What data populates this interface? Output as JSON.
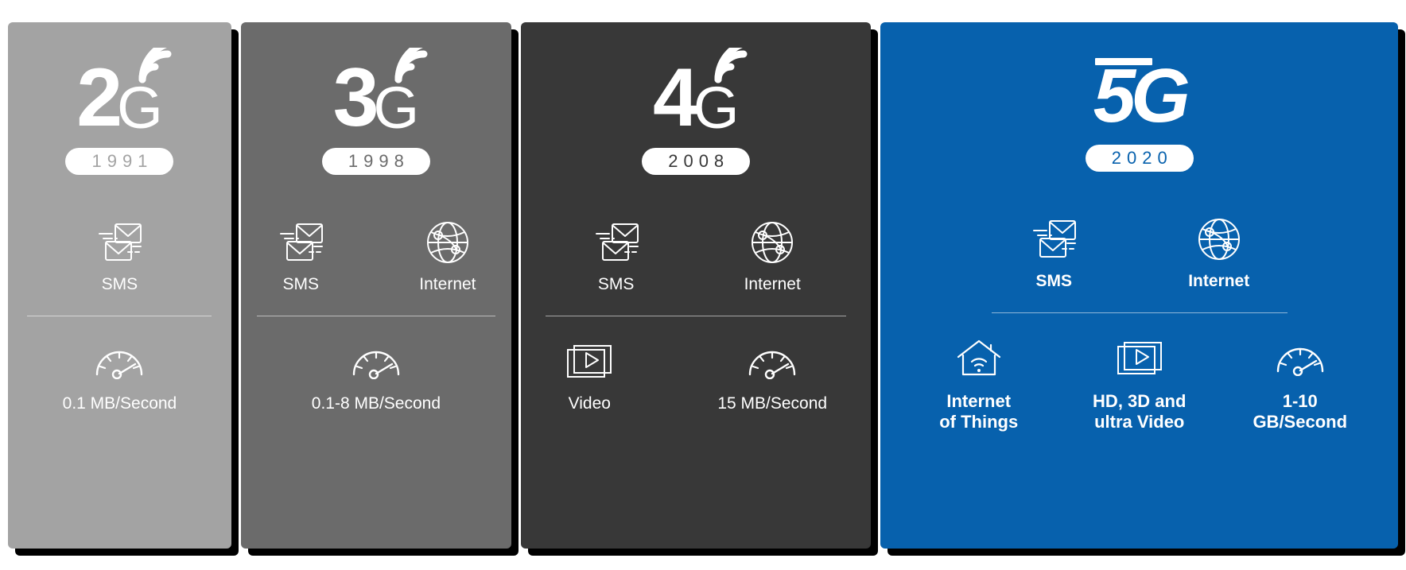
{
  "colors": {
    "panel_2g": "#a3a3a3",
    "panel_3g": "#6b6b6b",
    "panel_4g": "#383838",
    "panel_5g": "#0761ad",
    "text": "#ffffff",
    "shadow": "#000000"
  },
  "panels": [
    {
      "id": "2g",
      "generation_number": "2",
      "generation_letter": "G",
      "year": "1991",
      "rows": [
        {
          "position": "top",
          "features": [
            {
              "icon": "sms-icon",
              "label": "SMS"
            }
          ]
        },
        {
          "position": "bottom",
          "features": [
            {
              "icon": "speedometer-icon",
              "label": "0.1 MB/Second"
            }
          ]
        }
      ]
    },
    {
      "id": "3g",
      "generation_number": "3",
      "generation_letter": "G",
      "year": "1998",
      "rows": [
        {
          "position": "top",
          "features": [
            {
              "icon": "sms-icon",
              "label": "SMS"
            },
            {
              "icon": "globe-icon",
              "label": "Internet"
            }
          ]
        },
        {
          "position": "bottom",
          "features": [
            {
              "icon": "speedometer-icon",
              "label": "0.1-8 MB/Second"
            }
          ]
        }
      ]
    },
    {
      "id": "4g",
      "generation_number": "4",
      "generation_letter": "G",
      "year": "2008",
      "rows": [
        {
          "position": "top",
          "features": [
            {
              "icon": "sms-icon",
              "label": "SMS"
            },
            {
              "icon": "globe-icon",
              "label": "Internet"
            }
          ]
        },
        {
          "position": "bottom",
          "features": [
            {
              "icon": "video-icon",
              "label": "Video"
            },
            {
              "icon": "speedometer-icon",
              "label": "15 MB/Second"
            }
          ]
        }
      ]
    },
    {
      "id": "5g",
      "generation_number": "5",
      "generation_letter": "G",
      "year": "2020",
      "rows": [
        {
          "position": "top",
          "features": [
            {
              "icon": "sms-icon",
              "label": "SMS"
            },
            {
              "icon": "globe-icon",
              "label": "Internet"
            }
          ]
        },
        {
          "position": "bottom",
          "features": [
            {
              "icon": "smart-home-icon",
              "label": "Internet\nof Things"
            },
            {
              "icon": "video-icon",
              "label": "HD, 3D and\nultra Video"
            },
            {
              "icon": "speedometer-icon",
              "label": "1-10\nGB/Second"
            }
          ]
        }
      ]
    }
  ]
}
